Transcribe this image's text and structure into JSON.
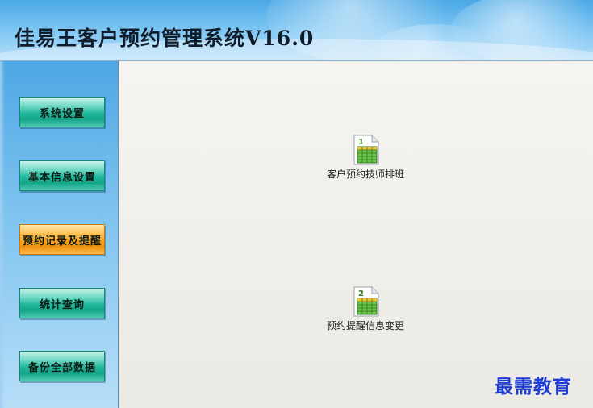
{
  "header": {
    "title": "佳易王客户预约管理系统V16.0"
  },
  "sidebar": {
    "items": [
      {
        "label": "系统设置",
        "active": false
      },
      {
        "label": "基本信息设置",
        "active": false
      },
      {
        "label": "预约记录及提醒",
        "active": true
      },
      {
        "label": "统计查询",
        "active": false
      },
      {
        "label": "备份全部数据",
        "active": false
      }
    ],
    "colors": {
      "normal": "#1fb79c",
      "active": "#f7a21c"
    }
  },
  "main": {
    "features": [
      {
        "label": "客户预约技师排班",
        "icon": "spreadsheet-icon",
        "badge": "1"
      },
      {
        "label": "预约提醒信息变更",
        "icon": "spreadsheet-icon",
        "badge": "2"
      }
    ]
  },
  "watermark": {
    "text": "最需教育"
  }
}
